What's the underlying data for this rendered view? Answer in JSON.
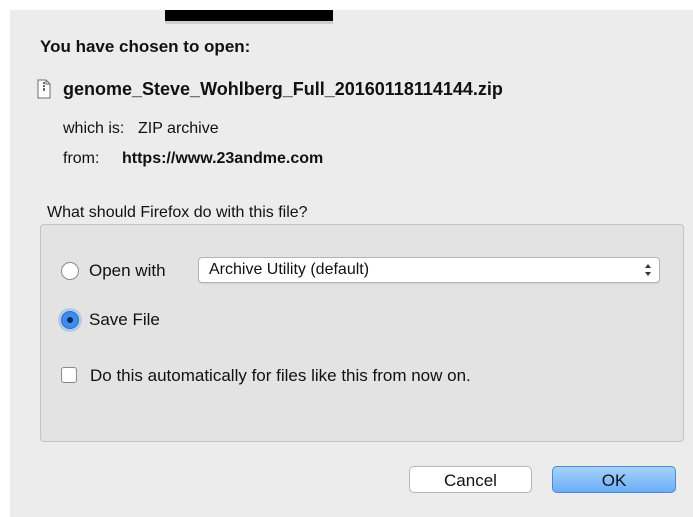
{
  "dialog": {
    "heading": "You have chosen to open:",
    "file": {
      "icon": "document-icon",
      "name": "genome_Steve_Wohlberg_Full_20160118114144.zip"
    },
    "type_label": "which is:",
    "type_value": "ZIP archive",
    "from_label": "from:",
    "from_value": "https://www.23andme.com",
    "question": "What should Firefox do with this file?",
    "open_with": {
      "label": "Open with",
      "selected": false,
      "app": "Archive Utility (default)"
    },
    "save_file": {
      "label": "Save File",
      "selected": true
    },
    "auto": {
      "label": "Do this automatically for files like this from now on.",
      "checked": false
    },
    "buttons": {
      "cancel": "Cancel",
      "ok": "OK"
    }
  },
  "colors": {
    "background": "#ececec",
    "accent": "#3b8ef0",
    "ok_button": "#6aaef6"
  }
}
